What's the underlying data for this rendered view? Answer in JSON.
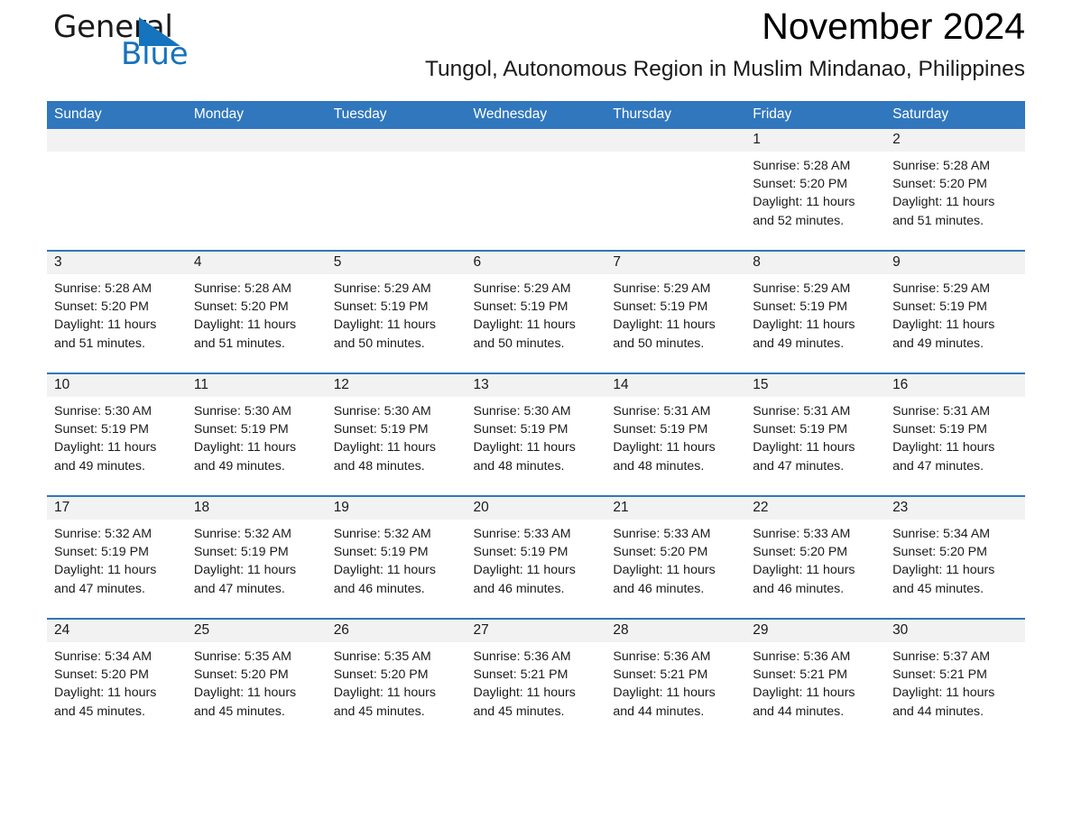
{
  "brand": {
    "word_one": "General",
    "word_two": "Blue",
    "triangle_icon": "triangle-icon",
    "accent_color": "#1673bd"
  },
  "header": {
    "title": "November 2024",
    "subtitle": "Tungol, Autonomous Region in Muslim Mindanao, Philippines"
  },
  "calendar": {
    "header_color": "#3077bd",
    "daynum_bg": "#f2f2f2",
    "weekday_headers": [
      "Sunday",
      "Monday",
      "Tuesday",
      "Wednesday",
      "Thursday",
      "Friday",
      "Saturday"
    ],
    "weeks": [
      [
        {
          "day": "",
          "sunrise": "",
          "sunset": "",
          "daylight_line1": "",
          "daylight_line2": ""
        },
        {
          "day": "",
          "sunrise": "",
          "sunset": "",
          "daylight_line1": "",
          "daylight_line2": ""
        },
        {
          "day": "",
          "sunrise": "",
          "sunset": "",
          "daylight_line1": "",
          "daylight_line2": ""
        },
        {
          "day": "",
          "sunrise": "",
          "sunset": "",
          "daylight_line1": "",
          "daylight_line2": ""
        },
        {
          "day": "",
          "sunrise": "",
          "sunset": "",
          "daylight_line1": "",
          "daylight_line2": ""
        },
        {
          "day": "1",
          "sunrise": "Sunrise: 5:28 AM",
          "sunset": "Sunset: 5:20 PM",
          "daylight_line1": "Daylight: 11 hours",
          "daylight_line2": "and 52 minutes."
        },
        {
          "day": "2",
          "sunrise": "Sunrise: 5:28 AM",
          "sunset": "Sunset: 5:20 PM",
          "daylight_line1": "Daylight: 11 hours",
          "daylight_line2": "and 51 minutes."
        }
      ],
      [
        {
          "day": "3",
          "sunrise": "Sunrise: 5:28 AM",
          "sunset": "Sunset: 5:20 PM",
          "daylight_line1": "Daylight: 11 hours",
          "daylight_line2": "and 51 minutes."
        },
        {
          "day": "4",
          "sunrise": "Sunrise: 5:28 AM",
          "sunset": "Sunset: 5:20 PM",
          "daylight_line1": "Daylight: 11 hours",
          "daylight_line2": "and 51 minutes."
        },
        {
          "day": "5",
          "sunrise": "Sunrise: 5:29 AM",
          "sunset": "Sunset: 5:19 PM",
          "daylight_line1": "Daylight: 11 hours",
          "daylight_line2": "and 50 minutes."
        },
        {
          "day": "6",
          "sunrise": "Sunrise: 5:29 AM",
          "sunset": "Sunset: 5:19 PM",
          "daylight_line1": "Daylight: 11 hours",
          "daylight_line2": "and 50 minutes."
        },
        {
          "day": "7",
          "sunrise": "Sunrise: 5:29 AM",
          "sunset": "Sunset: 5:19 PM",
          "daylight_line1": "Daylight: 11 hours",
          "daylight_line2": "and 50 minutes."
        },
        {
          "day": "8",
          "sunrise": "Sunrise: 5:29 AM",
          "sunset": "Sunset: 5:19 PM",
          "daylight_line1": "Daylight: 11 hours",
          "daylight_line2": "and 49 minutes."
        },
        {
          "day": "9",
          "sunrise": "Sunrise: 5:29 AM",
          "sunset": "Sunset: 5:19 PM",
          "daylight_line1": "Daylight: 11 hours",
          "daylight_line2": "and 49 minutes."
        }
      ],
      [
        {
          "day": "10",
          "sunrise": "Sunrise: 5:30 AM",
          "sunset": "Sunset: 5:19 PM",
          "daylight_line1": "Daylight: 11 hours",
          "daylight_line2": "and 49 minutes."
        },
        {
          "day": "11",
          "sunrise": "Sunrise: 5:30 AM",
          "sunset": "Sunset: 5:19 PM",
          "daylight_line1": "Daylight: 11 hours",
          "daylight_line2": "and 49 minutes."
        },
        {
          "day": "12",
          "sunrise": "Sunrise: 5:30 AM",
          "sunset": "Sunset: 5:19 PM",
          "daylight_line1": "Daylight: 11 hours",
          "daylight_line2": "and 48 minutes."
        },
        {
          "day": "13",
          "sunrise": "Sunrise: 5:30 AM",
          "sunset": "Sunset: 5:19 PM",
          "daylight_line1": "Daylight: 11 hours",
          "daylight_line2": "and 48 minutes."
        },
        {
          "day": "14",
          "sunrise": "Sunrise: 5:31 AM",
          "sunset": "Sunset: 5:19 PM",
          "daylight_line1": "Daylight: 11 hours",
          "daylight_line2": "and 48 minutes."
        },
        {
          "day": "15",
          "sunrise": "Sunrise: 5:31 AM",
          "sunset": "Sunset: 5:19 PM",
          "daylight_line1": "Daylight: 11 hours",
          "daylight_line2": "and 47 minutes."
        },
        {
          "day": "16",
          "sunrise": "Sunrise: 5:31 AM",
          "sunset": "Sunset: 5:19 PM",
          "daylight_line1": "Daylight: 11 hours",
          "daylight_line2": "and 47 minutes."
        }
      ],
      [
        {
          "day": "17",
          "sunrise": "Sunrise: 5:32 AM",
          "sunset": "Sunset: 5:19 PM",
          "daylight_line1": "Daylight: 11 hours",
          "daylight_line2": "and 47 minutes."
        },
        {
          "day": "18",
          "sunrise": "Sunrise: 5:32 AM",
          "sunset": "Sunset: 5:19 PM",
          "daylight_line1": "Daylight: 11 hours",
          "daylight_line2": "and 47 minutes."
        },
        {
          "day": "19",
          "sunrise": "Sunrise: 5:32 AM",
          "sunset": "Sunset: 5:19 PM",
          "daylight_line1": "Daylight: 11 hours",
          "daylight_line2": "and 46 minutes."
        },
        {
          "day": "20",
          "sunrise": "Sunrise: 5:33 AM",
          "sunset": "Sunset: 5:19 PM",
          "daylight_line1": "Daylight: 11 hours",
          "daylight_line2": "and 46 minutes."
        },
        {
          "day": "21",
          "sunrise": "Sunrise: 5:33 AM",
          "sunset": "Sunset: 5:20 PM",
          "daylight_line1": "Daylight: 11 hours",
          "daylight_line2": "and 46 minutes."
        },
        {
          "day": "22",
          "sunrise": "Sunrise: 5:33 AM",
          "sunset": "Sunset: 5:20 PM",
          "daylight_line1": "Daylight: 11 hours",
          "daylight_line2": "and 46 minutes."
        },
        {
          "day": "23",
          "sunrise": "Sunrise: 5:34 AM",
          "sunset": "Sunset: 5:20 PM",
          "daylight_line1": "Daylight: 11 hours",
          "daylight_line2": "and 45 minutes."
        }
      ],
      [
        {
          "day": "24",
          "sunrise": "Sunrise: 5:34 AM",
          "sunset": "Sunset: 5:20 PM",
          "daylight_line1": "Daylight: 11 hours",
          "daylight_line2": "and 45 minutes."
        },
        {
          "day": "25",
          "sunrise": "Sunrise: 5:35 AM",
          "sunset": "Sunset: 5:20 PM",
          "daylight_line1": "Daylight: 11 hours",
          "daylight_line2": "and 45 minutes."
        },
        {
          "day": "26",
          "sunrise": "Sunrise: 5:35 AM",
          "sunset": "Sunset: 5:20 PM",
          "daylight_line1": "Daylight: 11 hours",
          "daylight_line2": "and 45 minutes."
        },
        {
          "day": "27",
          "sunrise": "Sunrise: 5:36 AM",
          "sunset": "Sunset: 5:21 PM",
          "daylight_line1": "Daylight: 11 hours",
          "daylight_line2": "and 45 minutes."
        },
        {
          "day": "28",
          "sunrise": "Sunrise: 5:36 AM",
          "sunset": "Sunset: 5:21 PM",
          "daylight_line1": "Daylight: 11 hours",
          "daylight_line2": "and 44 minutes."
        },
        {
          "day": "29",
          "sunrise": "Sunrise: 5:36 AM",
          "sunset": "Sunset: 5:21 PM",
          "daylight_line1": "Daylight: 11 hours",
          "daylight_line2": "and 44 minutes."
        },
        {
          "day": "30",
          "sunrise": "Sunrise: 5:37 AM",
          "sunset": "Sunset: 5:21 PM",
          "daylight_line1": "Daylight: 11 hours",
          "daylight_line2": "and 44 minutes."
        }
      ]
    ]
  }
}
